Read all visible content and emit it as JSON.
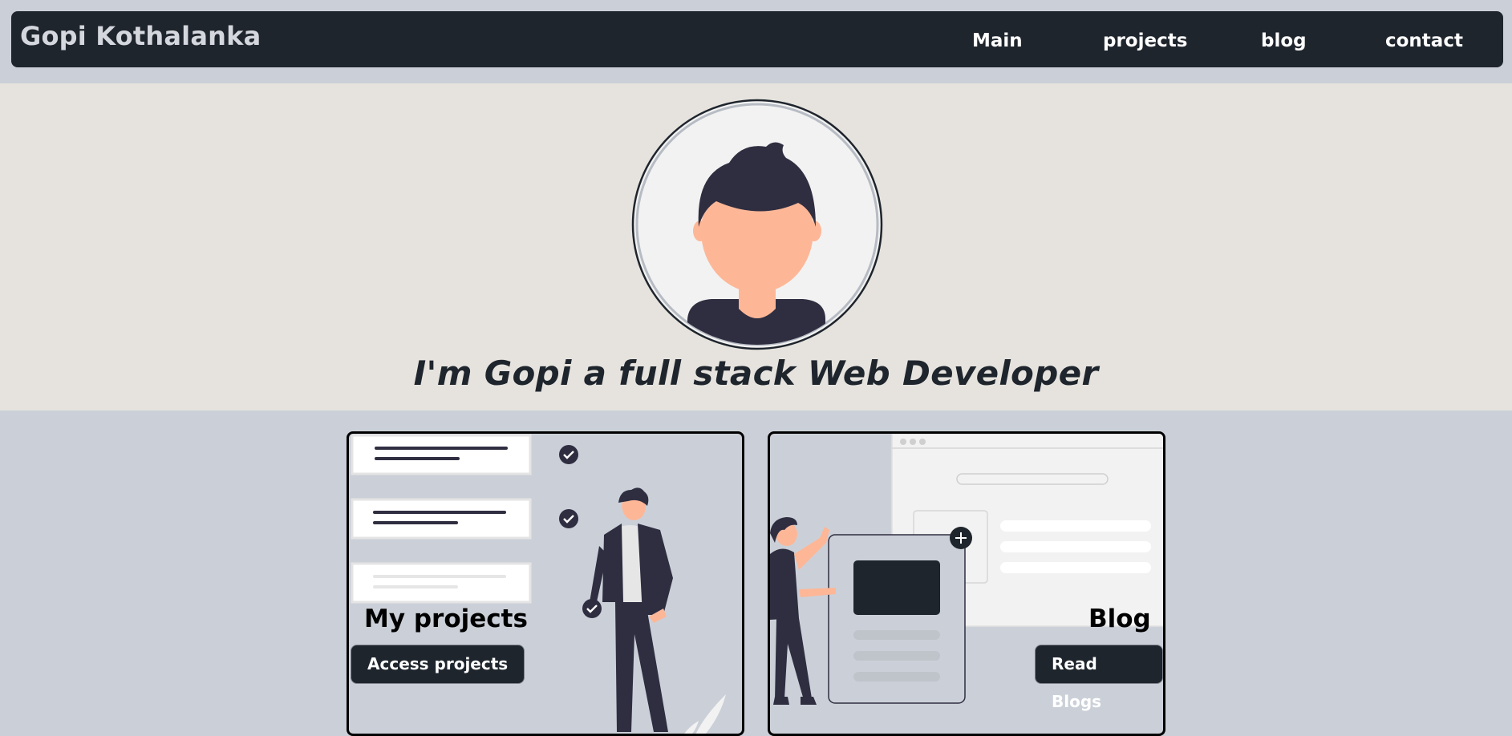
{
  "header": {
    "brand": "Gopi Kothalanka",
    "nav": [
      {
        "label": "Main"
      },
      {
        "label": "projects"
      },
      {
        "label": "blog"
      },
      {
        "label": "contact"
      }
    ]
  },
  "hero": {
    "tagline": "I'm Gopi a full stack Web Developer"
  },
  "cards": {
    "projects": {
      "title": "My projects",
      "button": "Access projects"
    },
    "blog": {
      "title": "Blog",
      "button": "Read Blogs"
    }
  },
  "colors": {
    "navbar": "#1f252d",
    "page_bg": "#cbd0d8",
    "hero_bg": "#e6e3de",
    "skin": "#fdb797",
    "hair": "#2f2e41"
  }
}
